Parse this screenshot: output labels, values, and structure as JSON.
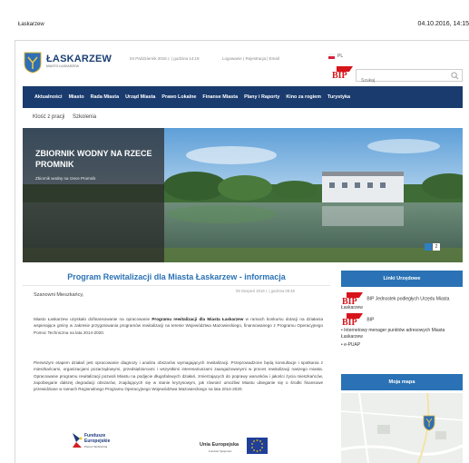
{
  "browser": {
    "tab_title": "Łaskarzew",
    "date_time": "04.10.2016, 14:15"
  },
  "header": {
    "logo_title": "ŁASKARZEW",
    "logo_subtitle": "MIASTO ŁASKARZEW",
    "date_line": "04 Październik 2016 r. | godzina 14:19",
    "account_links": "Logowanie | Rejestracja | Email",
    "language": "PL",
    "search_placeholder": "Szukaj"
  },
  "nav": {
    "items": [
      "Aktualności",
      "Miasto",
      "Rada Miasta",
      "Urząd Miasta",
      "Prawo Lokalne",
      "Finanse Miasta",
      "Plany i Raporty",
      "Kino za rogiem",
      "Turystyka"
    ]
  },
  "subtabs": [
    "Klość z pracji",
    "Szkolenia"
  ],
  "hero": {
    "title": "ZBIORNIK WODNY NA RZECE PROMNIK",
    "caption": "Zbiornik wodny na rzece Promnik",
    "pager": [
      "",
      "2"
    ]
  },
  "article": {
    "title": "Program Rewitalizacji dla Miasta Łaskarzew - informacja",
    "date": "09 Sierpień 2016 r. | godzina 08:48",
    "greeting": "Szanowni Mieszkańcy,",
    "p1_a": "Miasto Łaskarzew uzyskało dofinansowanie na opracowanie ",
    "p1_bold1": "Programu rewitalizacji dla Miasta Łaskarzew",
    "p1_b": " w ramach konkursu dotacji na działania wspierające gminy w zakresie przygotowania programów rewitalizacji na terenie Województwa Mazowieckiego, finansowanego z Programu Operacyjnego Pomoc Techniczna na lata 2014-2020.",
    "p2": "Pierwszym etapem działań jest opracowanie diagnozy i analiza obszarów wymagających rewitalizacji. Przeprowadzone będą konsultacje i spotkania z mieszkańcami, organizacjami pozarządowymi, przedsiębiorcami i wszystkimi interesariuszami zaangażowanymi w proces rewitalizacji naszego miasta. Opracowanie programu rewitalizacji pozwoli Miastu na podjęcie długofalowych działań, zmierzających do poprawy warunków i jakości życia mieszkańców, zapobiegarie dalszej degradacji obszarów, znajdujących się w stanie kryzysowym, jak również umożliwi Miastu ubieganie się o środki finansowe przewidziane w ramach Regionalnego Programu Operacyjnego Województwa Mazowieckiego na lata 2014-2020.",
    "eu_funds_title": "Fundusze Europejskie",
    "eu_funds_sub": "Pomoc Techniczna",
    "eu_union_title": "Unia Europejska",
    "eu_union_sub": "Fundusz Spójności"
  },
  "sidebar": {
    "links_header": "Linki Urzędowe",
    "links": [
      "BIP Jednostek podległych Urzędu Miasta Łaskarzew",
      "BIP",
      "Internetowy menager punktów adresowych Miasta Łaskarzew",
      "e-PUAP"
    ],
    "map_header": "Moja mapa"
  },
  "colors": {
    "nav_bg": "#1a3b6e",
    "accent": "#2a72b5",
    "bip_red": "#d7141a"
  }
}
